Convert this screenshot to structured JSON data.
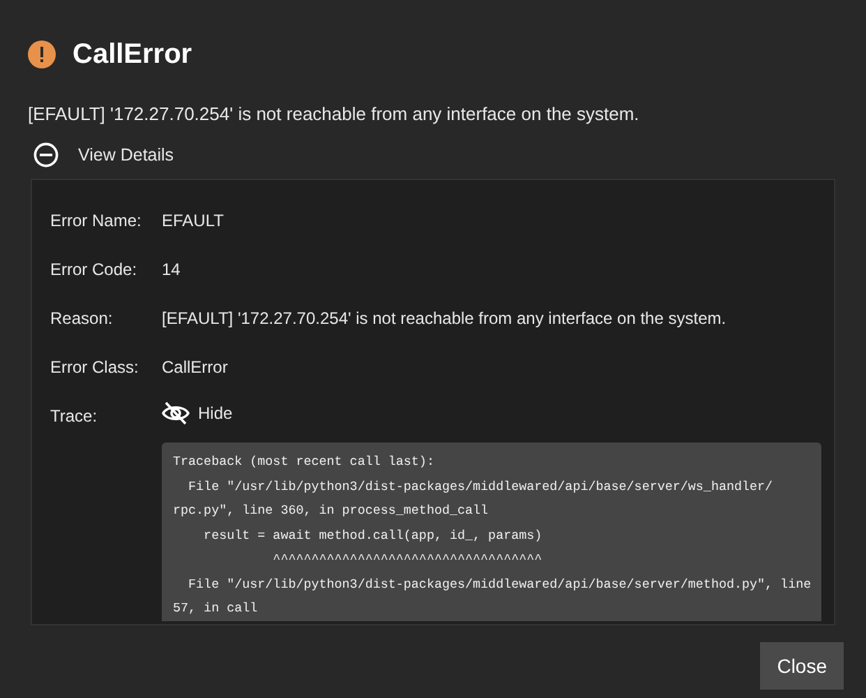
{
  "dialog": {
    "title": "CallError",
    "message": "[EFAULT] '172.27.70.254' is not reachable from any interface on the system.",
    "details_toggle": {
      "label": "View Details",
      "expanded": true
    },
    "details": [
      {
        "label": "Error Name:",
        "value": "EFAULT"
      },
      {
        "label": "Error Code:",
        "value": "14"
      },
      {
        "label": "Reason:",
        "value": "[EFAULT] '172.27.70.254' is not reachable from any interface on the system."
      },
      {
        "label": "Error Class:",
        "value": "CallError"
      }
    ],
    "trace": {
      "label": "Trace:",
      "toggle_label": "Hide",
      "visible": true,
      "lines": [
        "Traceback (most recent call last):",
        "  File \"/usr/lib/python3/dist-packages/middlewared/api/base/server/ws_handler/",
        "rpc.py\", line 360, in process_method_call",
        "    result = await method.call(app, id_, params)",
        "             ^^^^^^^^^^^^^^^^^^^^^^^^^^^^^^^^^^^",
        "  File \"/usr/lib/python3/dist-packages/middlewared/api/base/server/method.py\", line",
        "57, in call"
      ]
    },
    "buttons": [
      "Close"
    ]
  }
}
